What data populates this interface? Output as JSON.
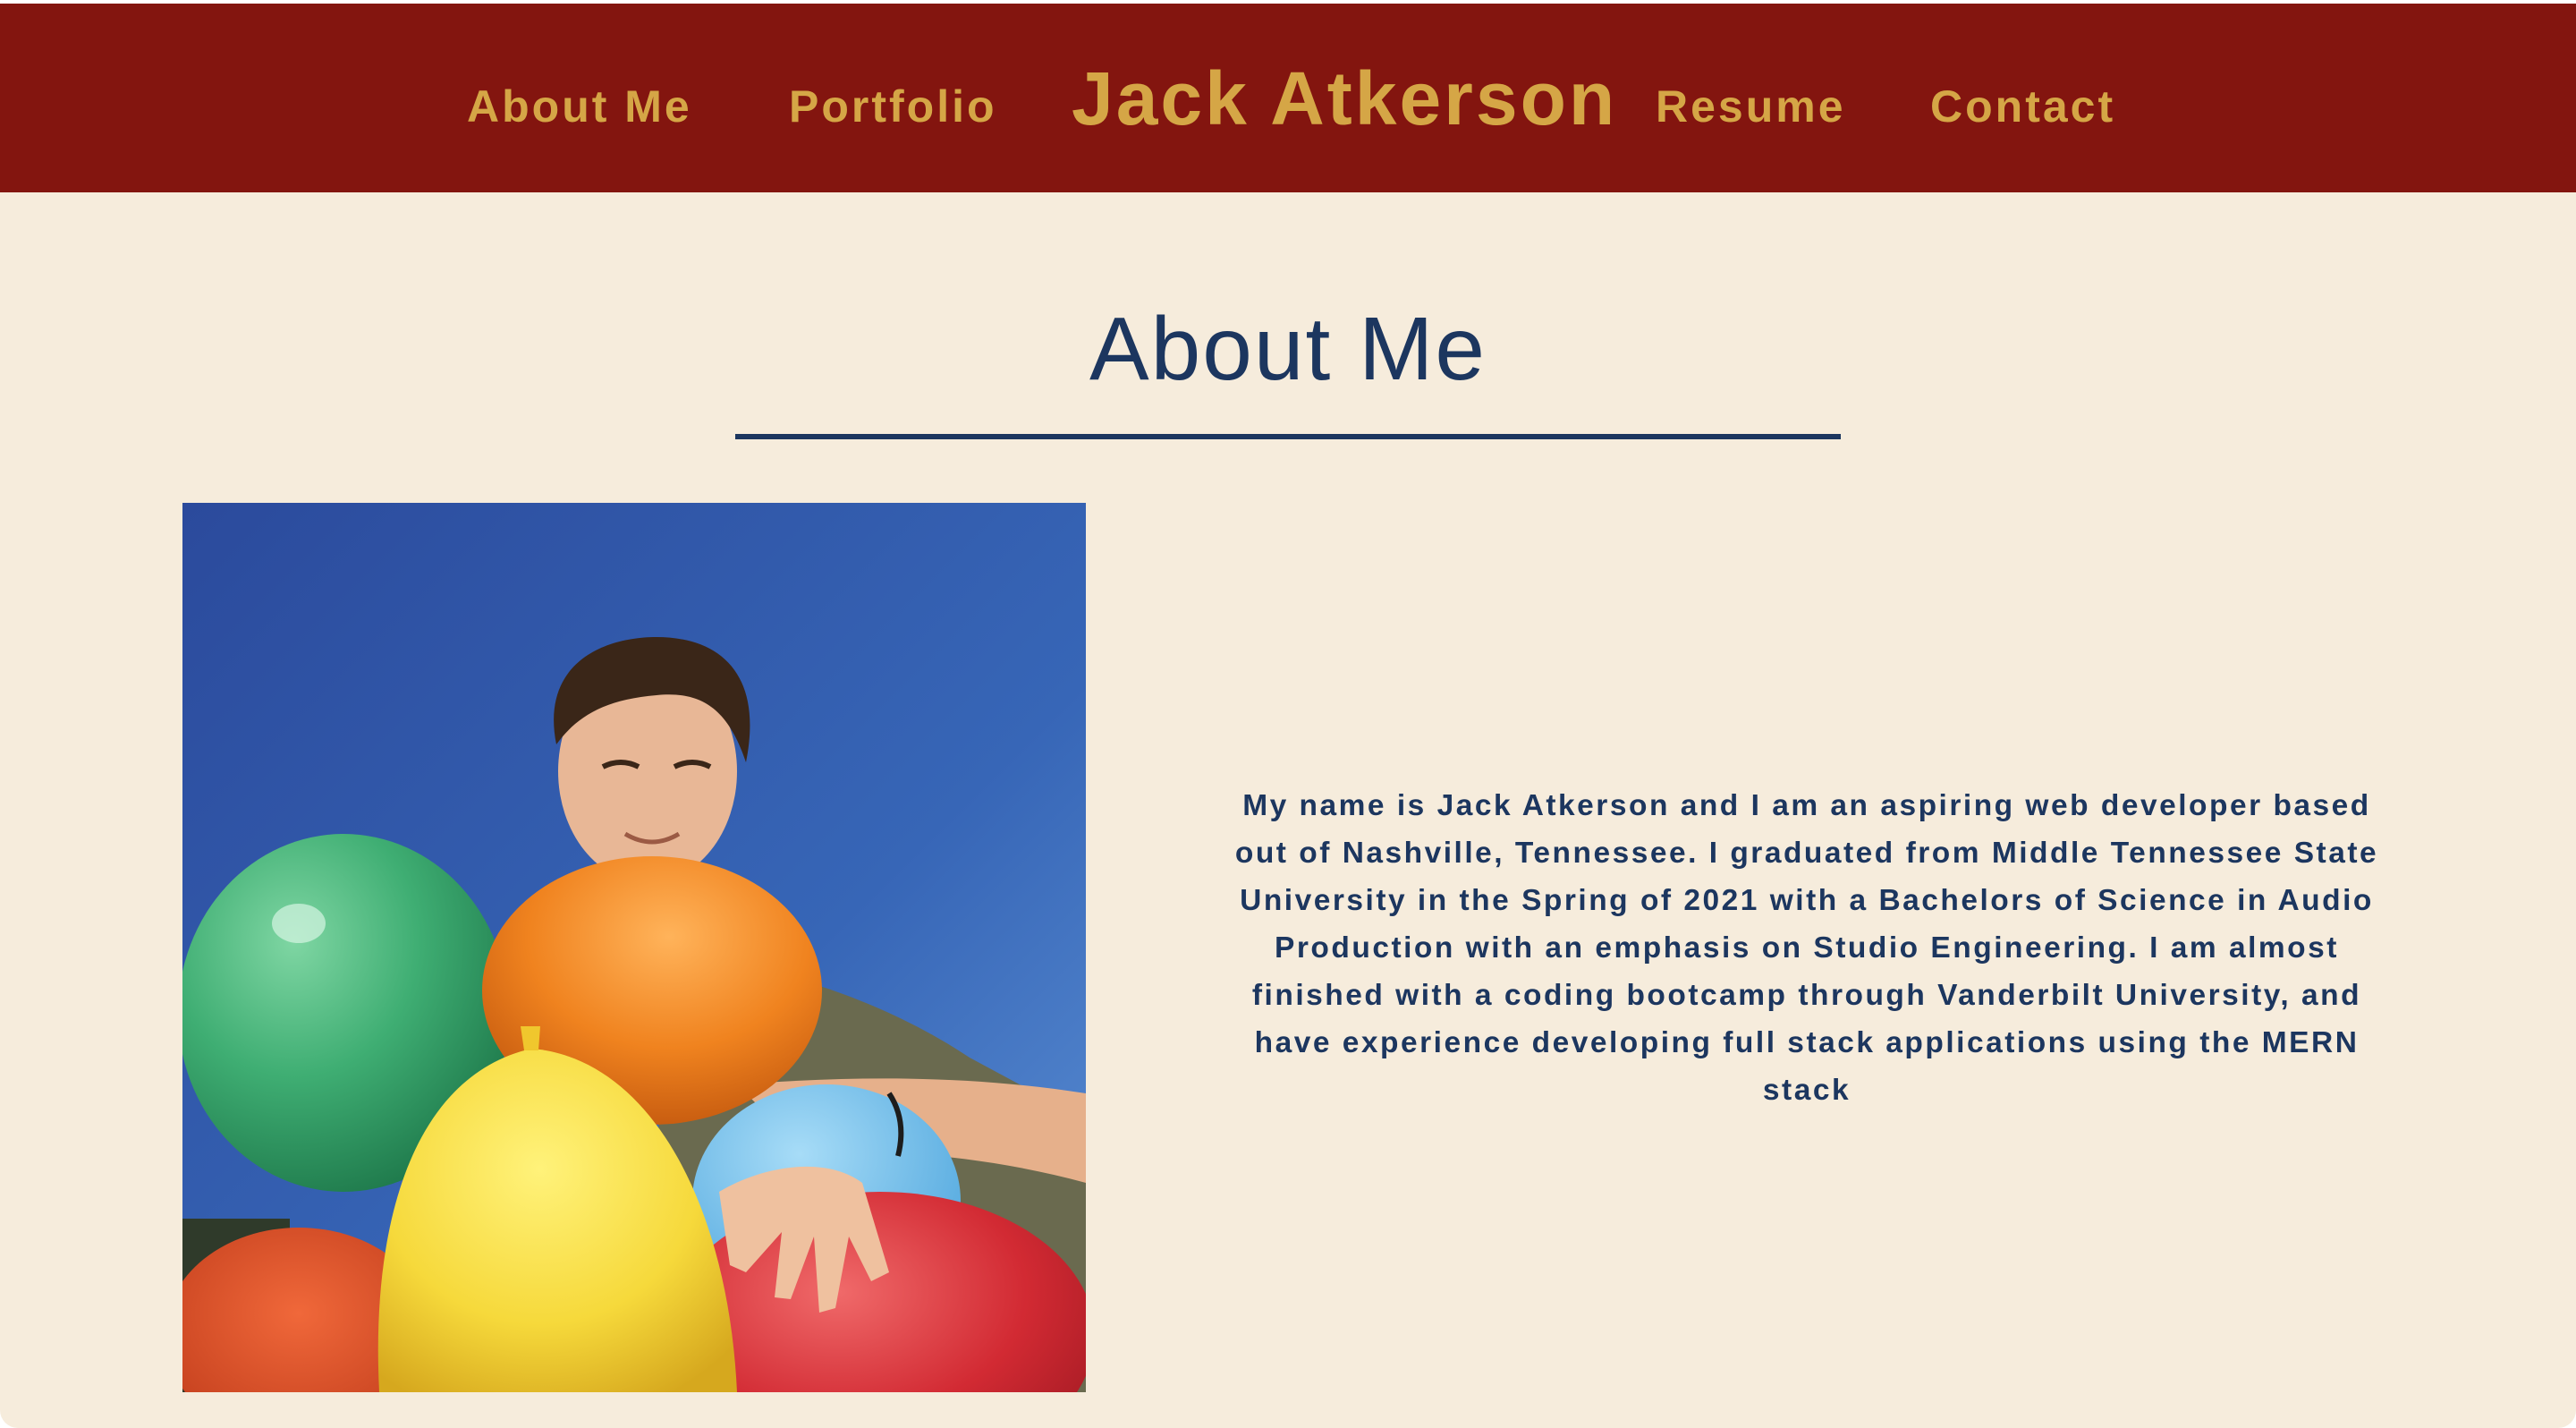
{
  "header": {
    "brand": "Jack Atkerson",
    "nav": [
      {
        "label": "About Me"
      },
      {
        "label": "Portfolio"
      },
      {
        "label": "Resume"
      },
      {
        "label": "Contact"
      }
    ]
  },
  "about": {
    "title": "About Me",
    "bio": "My name is Jack Atkerson and I am an aspiring web developer based out of Nashville, Tennessee. I graduated from Middle Tennessee State University in the Spring of 2021 with a Bachelors of Science in Audio Production with an emphasis on Studio Engineering. I am almost finished with a coding bootcamp through Vanderbilt University, and have experience developing full stack applications using the MERN stack"
  },
  "colors": {
    "header_bg": "#83150f",
    "accent_gold": "#d5a646",
    "page_bg": "#f6ecdc",
    "navy": "#1c365f"
  }
}
